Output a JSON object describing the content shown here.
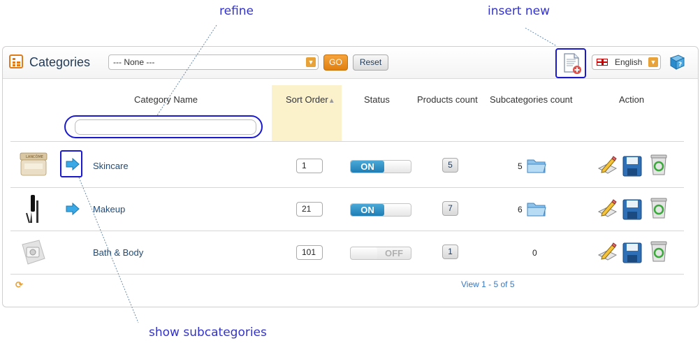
{
  "callouts": {
    "refine": "refine",
    "insert_new": "insert new",
    "show_subcategories": "show subcategories"
  },
  "header": {
    "title": "Categories",
    "filter_select_value": "--- None ---",
    "go_label": "GO",
    "reset_label": "Reset",
    "language": "English"
  },
  "columns": {
    "name": "Category Name",
    "sort_order": "Sort Order",
    "status": "Status",
    "products_count": "Products count",
    "subcategories_count": "Subcategories count",
    "action": "Action"
  },
  "rows": [
    {
      "name": "Skincare",
      "sort_order": "1",
      "status": "ON",
      "products": "5",
      "subcategories": "5",
      "has_children": true,
      "thumbnail": "cream-jar-image"
    },
    {
      "name": "Makeup",
      "sort_order": "21",
      "status": "ON",
      "products": "7",
      "subcategories": "6",
      "has_children": true,
      "thumbnail": "mascara-image"
    },
    {
      "name": "Bath & Body",
      "sort_order": "101",
      "status": "OFF",
      "products": "1",
      "subcategories": "0",
      "has_children": false,
      "thumbnail": "placeholder-image"
    }
  ],
  "pager": "View 1 - 5 of 5",
  "colors": {
    "callout": "#3333cc",
    "accent": "#e8a23a",
    "toggle_on": "#1f7db4",
    "link": "#1f4a78",
    "sort_highlight": "#fbf2cc"
  }
}
